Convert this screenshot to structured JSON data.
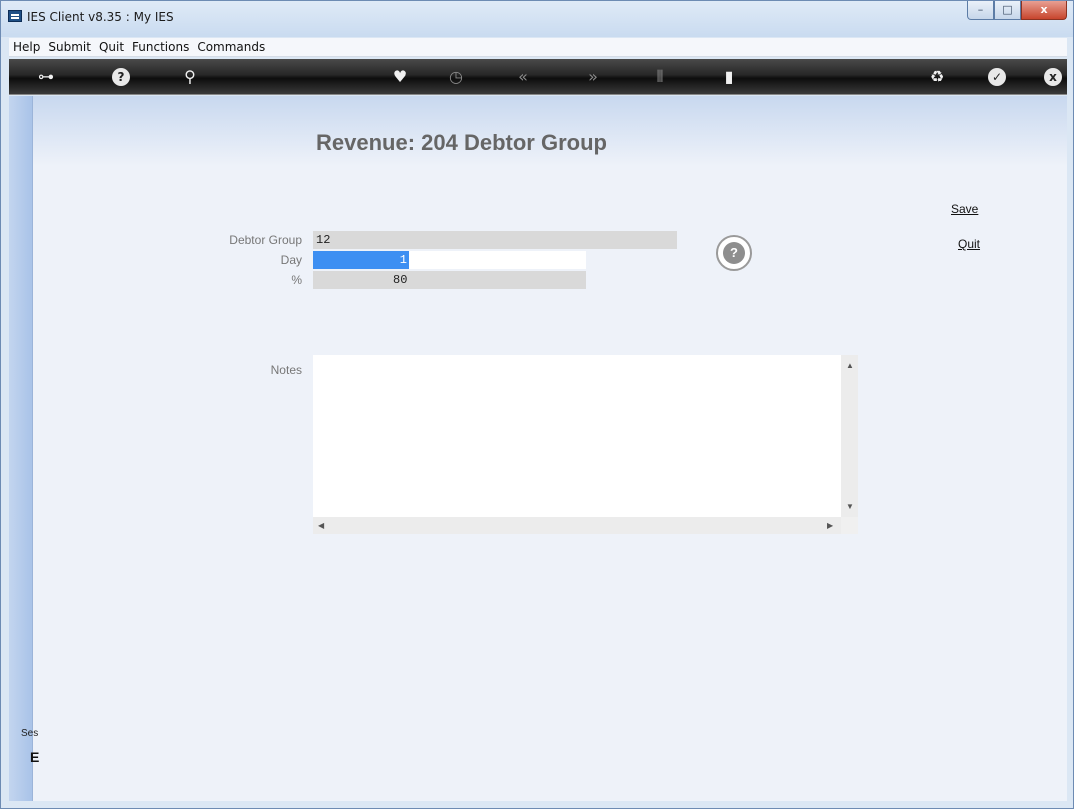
{
  "window": {
    "title": "IES Client v8.35 : My IES",
    "minimize": "–",
    "maximize": "□",
    "close": "x"
  },
  "menu": [
    {
      "label": "Help"
    },
    {
      "label": "Submit"
    },
    {
      "label": "Quit"
    },
    {
      "label": "Functions"
    },
    {
      "label": "Commands"
    }
  ],
  "toolbar": {
    "key": "⊶",
    "help": "?",
    "search": "⚲",
    "favorite": "♥",
    "history": "◷",
    "back": "«",
    "forward": "»",
    "tools": "⫴",
    "screen": "▮",
    "recycle": "♻",
    "ok": "✓",
    "close": "x"
  },
  "form": {
    "title": "Revenue: 204 Debtor Group",
    "debtor_group_label": "Debtor Group",
    "debtor_group_value": "12",
    "day_label": "Day",
    "day_value": "1",
    "percent_label": "%",
    "percent_value": "80",
    "notes_label": "Notes",
    "notes_value": "",
    "help": "?"
  },
  "actions": {
    "save": "Save",
    "quit": "Quit"
  },
  "scroll": {
    "up": "▲",
    "down": "▼",
    "left": "◀",
    "right": "▶"
  },
  "sidebar": {
    "session_label": "Ses",
    "session_glyph": "E"
  }
}
